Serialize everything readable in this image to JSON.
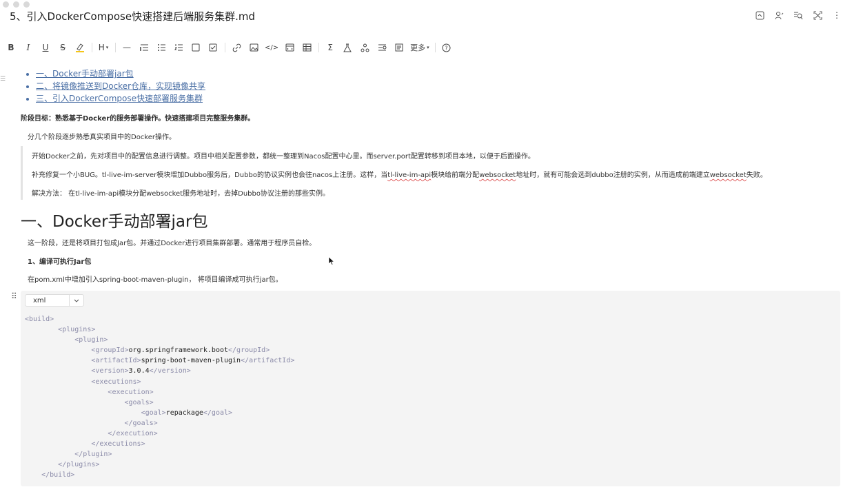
{
  "window": {
    "title": "5、引入DockerCompose快速搭建后端服务集群.md"
  },
  "toolbar": {
    "more_label": "更多"
  },
  "toc": [
    "一、Docker手动部署jar包",
    "二、将镜像推送到Docker仓库，实现镜像共享",
    "三、引入DockerCompose快速部署服务集群"
  ],
  "content": {
    "goal": "阶段目标：熟悉基于Docker的服务部署操作。快速搭建项目完整服务集群。",
    "intro": "分几个阶段逐步熟悉真实项目中的Docker操作。",
    "quote1": "开始Docker之前，先对项目中的配置信息进行调整。项目中相关配置参数，都统一整理到Nacos配置中心里。而server.port配置转移到项目本地，以便于后面操作。",
    "quote2_a": "补充修复一个小BUG。tl-live-im-server模块增加Dubbo服务后，Dubbo的协议实例也会往nacos上注册。这样，当",
    "quote2_b": "tl-live-im-api",
    "quote2_c": "模块给前端分配",
    "quote2_d": "websocket",
    "quote2_e": "地址时，就有可能会选到dubbo注册的实例，从而造成前端建立",
    "quote2_f": "websocket",
    "quote2_g": "失败。",
    "quote3": "解决方法： 在tl-live-im-api模块分配websocket服务地址时，去掉Dubbo协议注册的那些实例。",
    "h1": "一、Docker手动部署jar包",
    "p1": "这一阶段，还是将项目打包成Jar包。并通过Docker进行项目集群部署。通常用于程序员自检。",
    "h4": "1、编译可执行Jar包",
    "p2": "在pom.xml中增加引入spring-boot-maven-plugin， 将项目编译成可执行jar包。"
  },
  "code": {
    "language": "xml",
    "group_id": "org.springframework.boot",
    "artifact_id": "spring-boot-maven-plugin",
    "version": "3.0.4",
    "goal": "repackage"
  }
}
